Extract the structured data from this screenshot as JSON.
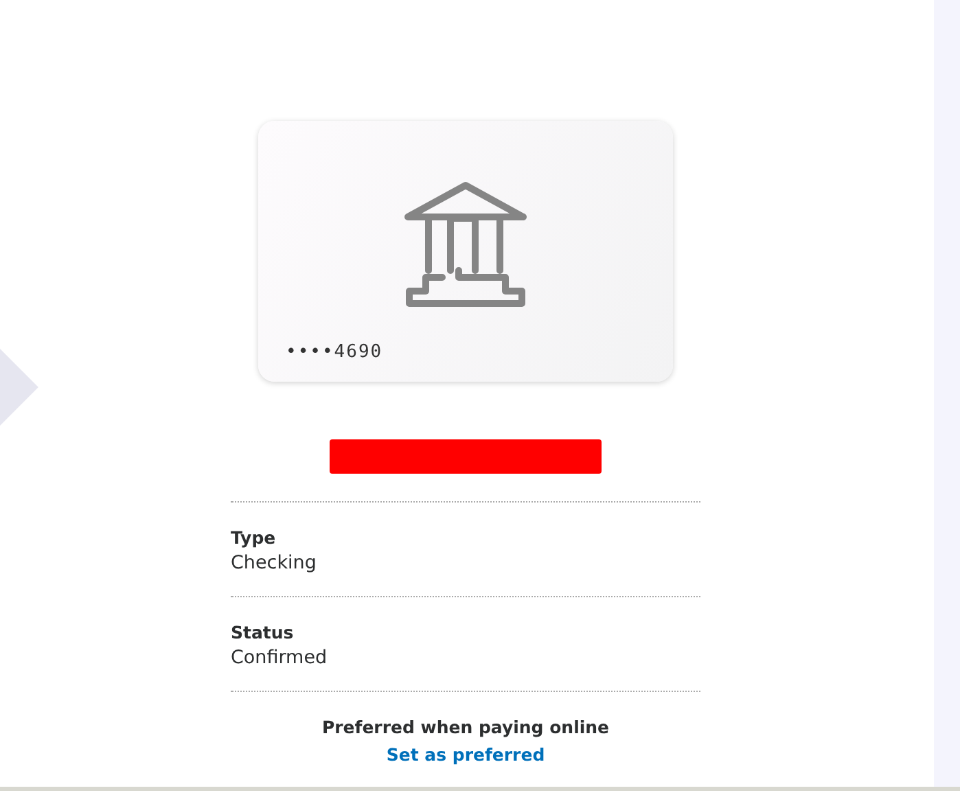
{
  "card": {
    "number": "••••4690"
  },
  "details": [
    {
      "label": "Type",
      "value": "Checking"
    },
    {
      "label": "Status",
      "value": "Confirmed"
    }
  ],
  "preferred": {
    "text": "Preferred when paying online",
    "link": "Set as preferred"
  }
}
